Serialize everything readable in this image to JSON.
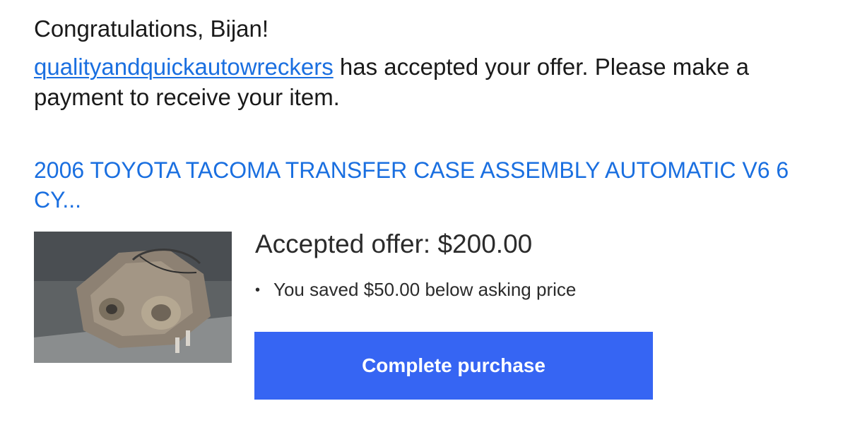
{
  "greeting": "Congratulations, Bijan!",
  "message": {
    "seller_name": "qualityandquickautowreckers",
    "text": " has accepted your offer. Please make a payment to receive your item."
  },
  "item": {
    "title": "2006 TOYOTA TACOMA TRANSFER CASE ASSEMBLY AUTOMATIC V6 6 CY...",
    "image_alt": "transfer-case-photo"
  },
  "offer": {
    "heading": "Accepted offer: $200.00",
    "savings_bullet": "•",
    "savings_text": "You saved $50.00 below asking price"
  },
  "cta": {
    "label": "Complete purchase"
  },
  "colors": {
    "link": "#1a6fe0",
    "button": "#3665f3",
    "text": "#1a1a1a"
  }
}
